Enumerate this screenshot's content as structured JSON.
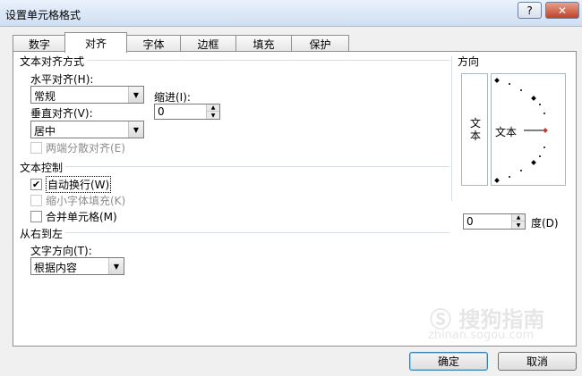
{
  "window": {
    "title": "设置单元格格式",
    "help_label": "?",
    "close_label": "✕"
  },
  "tabs": [
    {
      "label": "数字"
    },
    {
      "label": "对齐"
    },
    {
      "label": "字体"
    },
    {
      "label": "边框"
    },
    {
      "label": "填充"
    },
    {
      "label": "保护"
    }
  ],
  "active_tab": "对齐",
  "text_alignment": {
    "heading": "文本对齐方式",
    "horizontal_label": "水平对齐(H):",
    "horizontal_value": "常规",
    "indent_label": "缩进(I):",
    "indent_value": "0",
    "vertical_label": "垂直对齐(V):",
    "vertical_value": "居中",
    "distributed_label": "两端分散对齐(E)"
  },
  "text_control": {
    "heading": "文本控制",
    "wrap_text_label": "自动换行(W)",
    "wrap_text_checked": true,
    "shrink_label": "缩小字体填充(K)",
    "shrink_checked": false,
    "merge_label": "合并单元格(M)",
    "merge_checked": false
  },
  "rtl": {
    "heading": "从右到左",
    "direction_label": "文字方向(T):",
    "direction_value": "根据内容"
  },
  "orientation": {
    "heading": "方向",
    "vertical_text": "文本",
    "dial_text": "文本",
    "degrees_value": "0",
    "degrees_label": "度(D)"
  },
  "buttons": {
    "ok": "确定",
    "cancel": "取消"
  },
  "watermark": {
    "brand": "搜狗指南",
    "url": "zhinan.sogou.com"
  },
  "colors": {
    "dial_accent": "#c0392b",
    "default_button_border": "#3c7fb1"
  }
}
